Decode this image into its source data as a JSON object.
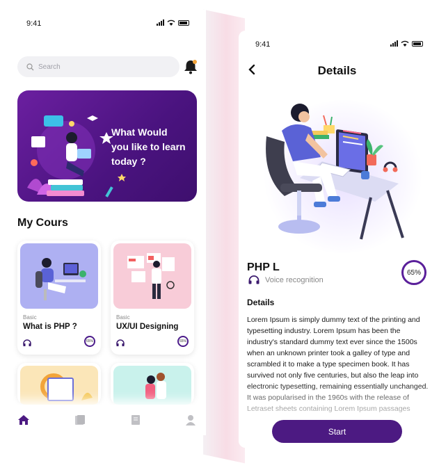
{
  "left": {
    "status": {
      "time": "9:41"
    },
    "search": {
      "placeholder": "Search"
    },
    "banner": {
      "line1": "What Would",
      "line2": "you like to learn",
      "line3": "today ?"
    },
    "section_title": "My Cours",
    "courses": [
      {
        "level": "Basic",
        "name": "What is PHP ?",
        "progress": "65%"
      },
      {
        "level": "Basic",
        "name": "UX/UI Designing",
        "progress": "65%"
      }
    ],
    "tabs": [
      "home-icon",
      "library-icon",
      "book-icon",
      "profile-icon"
    ]
  },
  "right": {
    "status": {
      "time": "9:41"
    },
    "title": "Details",
    "course_name": "PHP L",
    "course_sub": "Voice recognition",
    "progress": "65%",
    "details_heading": "Details",
    "details_body": "Lorem Ipsum is simply dummy text of the printing and typesetting industry. Lorem Ipsum has been the industry's standard dummy text ever since the 1500s when an unknown printer took a galley of type and scrambled it to make a type specimen book. It has survived not only five centuries, but also the leap into electronic typesetting, remaining essentially unchanged. It was popularised in the 1960s with the release of Letraset sheets containing Lorem Ipsum passages",
    "start_label": "Start"
  },
  "colors": {
    "accent": "#4c1a82",
    "banner": "#5a1890",
    "card_blue": "#aeb0f2",
    "card_pink": "#f8ccd8"
  }
}
